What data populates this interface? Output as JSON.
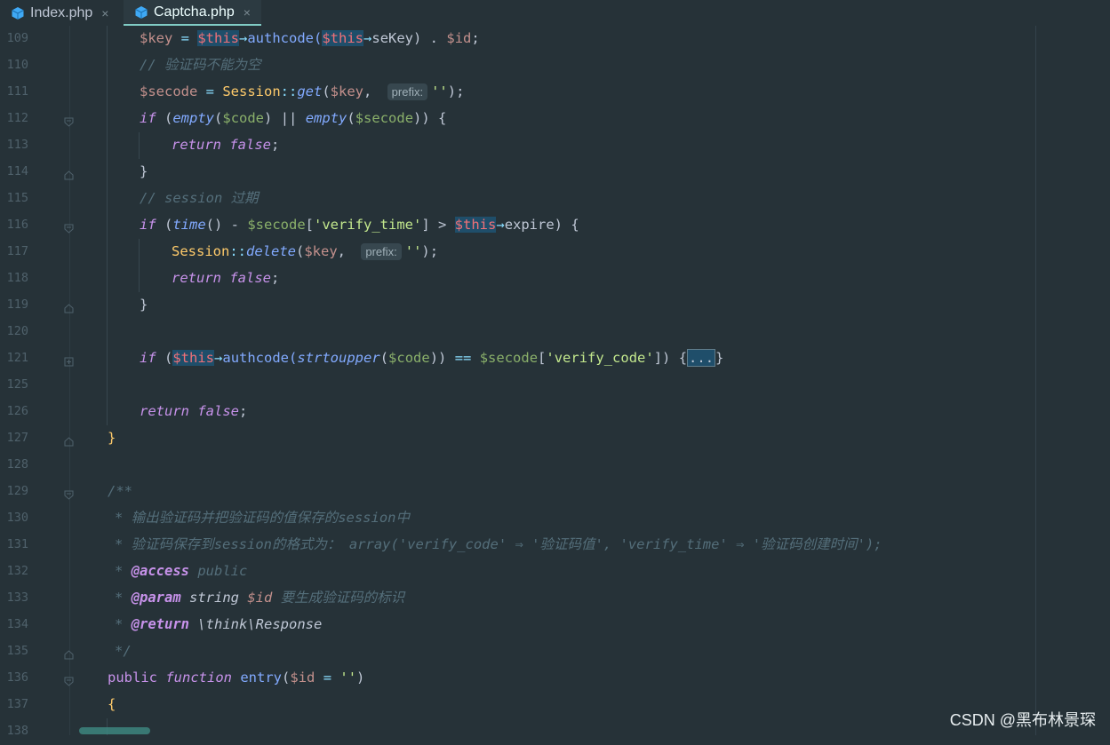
{
  "tabs": [
    {
      "label": "Index.php",
      "icon": "php-file-icon",
      "close": "×",
      "active": false
    },
    {
      "label": "Captcha.php",
      "icon": "php-file-icon",
      "close": "×",
      "active": true
    }
  ],
  "lines": [
    {
      "num": "109"
    },
    {
      "num": "110"
    },
    {
      "num": "111",
      "inlay": "prefix:"
    },
    {
      "num": "112"
    },
    {
      "num": "113"
    },
    {
      "num": "114"
    },
    {
      "num": "115"
    },
    {
      "num": "116"
    },
    {
      "num": "117",
      "inlay": "prefix:"
    },
    {
      "num": "118"
    },
    {
      "num": "119"
    },
    {
      "num": "120"
    },
    {
      "num": "121",
      "fold_placeholder": "..."
    },
    {
      "num": "125"
    },
    {
      "num": "126"
    },
    {
      "num": "127"
    },
    {
      "num": "128"
    },
    {
      "num": "129"
    },
    {
      "num": "130"
    },
    {
      "num": "131"
    },
    {
      "num": "132"
    },
    {
      "num": "133"
    },
    {
      "num": "134"
    },
    {
      "num": "135"
    },
    {
      "num": "136"
    },
    {
      "num": "137"
    },
    {
      "num": "138"
    }
  ],
  "code": {
    "l109": [
      "$key",
      " = ",
      "$this",
      "→",
      "authcode(",
      "$this",
      "→",
      "seKey) . ",
      "$id",
      ";"
    ],
    "l110": "// 验证码不能为空",
    "l111": [
      "$secode",
      " = ",
      "Session",
      "::",
      "get",
      "(",
      "$key",
      ", ",
      "''",
      ");"
    ],
    "l112": [
      "if",
      " (",
      "empty",
      "(",
      "$code",
      ") || ",
      "empty",
      "(",
      "$secode",
      ")) {"
    ],
    "l113": [
      "return",
      " ",
      "false",
      ";"
    ],
    "l114": "}",
    "l115": "// session 过期",
    "l116": [
      "if",
      " (",
      "time",
      "() - ",
      "$secode",
      "[",
      "'verify_time'",
      "] > ",
      "$this",
      "→",
      "expire) {"
    ],
    "l117": [
      "Session",
      "::",
      "delete",
      "(",
      "$key",
      ", ",
      "''",
      ");"
    ],
    "l118": [
      "return",
      " ",
      "false",
      ";"
    ],
    "l119": "}",
    "l121": [
      "if",
      " (",
      "$this",
      "→",
      "authcode(",
      "strtoupper",
      "(",
      "$code",
      ")) ",
      "==",
      " ",
      "$secode",
      "[",
      "'verify_code'",
      "]) {",
      "}"
    ],
    "l126": [
      "return",
      " ",
      "false",
      ";"
    ],
    "l127": "}",
    "l129": "/**",
    "l130": [
      "* ",
      "输出验证码并把验证码的值保存的",
      "session",
      "中"
    ],
    "l131": [
      "* ",
      "验证码保存到",
      "session",
      "的格式为： ",
      "array('verify_code' ⇒ '验证码值', 'verify_time' ⇒ '验证码创建时间');"
    ],
    "l132": [
      "* ",
      "@access",
      " public"
    ],
    "l133": [
      "* ",
      "@param",
      " string ",
      "$id",
      " 要生成验证码的标识"
    ],
    "l134": [
      "* ",
      "@return",
      " \\think\\Response"
    ],
    "l135": "*/",
    "l136": [
      "public",
      " ",
      "function",
      " ",
      "entry",
      "(",
      "$id",
      " = ",
      "''",
      ")"
    ],
    "l137": "{"
  },
  "colors": {
    "background": "#263238",
    "variable": "#c3908c",
    "this": "#f07178",
    "keyword": "#c792ea",
    "function": "#82aaff",
    "string": "#c3e88d",
    "class": "#ffcb6b",
    "comment": "#546e7a",
    "operator": "#89ddff"
  },
  "watermark": "CSDN @黑布林景琛"
}
